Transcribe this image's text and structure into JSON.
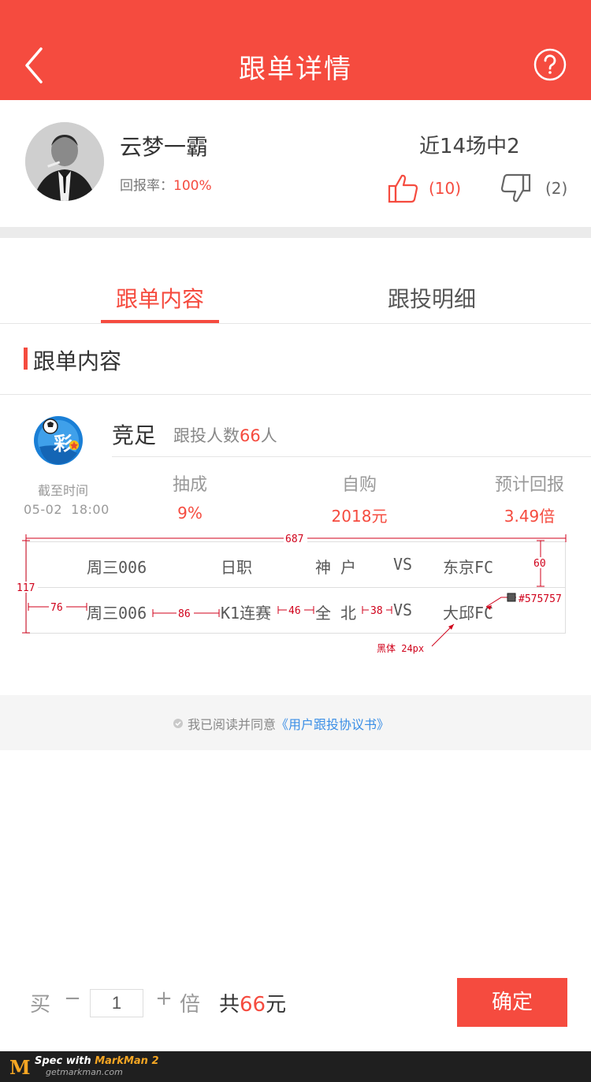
{
  "header": {
    "title": "跟单详情"
  },
  "profile": {
    "name": "云梦一霸",
    "return_rate_label": "回报率：",
    "return_rate_value": "100%",
    "record": "近14场中2",
    "likes": "(10)",
    "dislikes": "(2)"
  },
  "tabs": [
    {
      "label": "跟单内容",
      "active": true
    },
    {
      "label": "跟投明细",
      "active": false
    }
  ],
  "section_title": "跟单内容",
  "order": {
    "lottery": "竞足",
    "followers_prefix": "跟投人数",
    "followers_count": "66",
    "followers_suffix": "人",
    "deadline_label": "截至时间",
    "deadline_value": "05-02  18:00",
    "stats": [
      {
        "label": "抽成",
        "value": "9%"
      },
      {
        "label": "自购",
        "value": "2018元"
      },
      {
        "label": "预计回报",
        "value": "3.49倍"
      }
    ],
    "matches": [
      {
        "no": "周三006",
        "league": "日职",
        "home": "神 户",
        "vs": "VS",
        "away": "东京FC"
      },
      {
        "no": "周三006",
        "league": "K1连赛",
        "home": "全 北",
        "vs": "VS",
        "away": "大邱FC"
      }
    ]
  },
  "annotations": {
    "width": "687",
    "height_total": "117",
    "row_height": "60",
    "left_pad": "76",
    "gap1": "86",
    "gap2": "46",
    "gap3": "38",
    "color_note": "#575757",
    "font_note": "黑体 24px"
  },
  "agreement": {
    "text": "我已阅读并同意",
    "link": "《用户跟投协议书》"
  },
  "bottom": {
    "buy": "买",
    "minus": "−",
    "quantity": "1",
    "plus": "+",
    "times": "倍",
    "total_prefix": "共",
    "total_amount": "66",
    "total_suffix": "元",
    "confirm": "确定"
  },
  "footer": {
    "spec_prefix": "Spec with ",
    "brand": "MarkMan 2",
    "site": "getmarkman.com"
  },
  "colors": {
    "accent": "#f54b3f",
    "text": "#575757",
    "link": "#3a8ee6"
  }
}
